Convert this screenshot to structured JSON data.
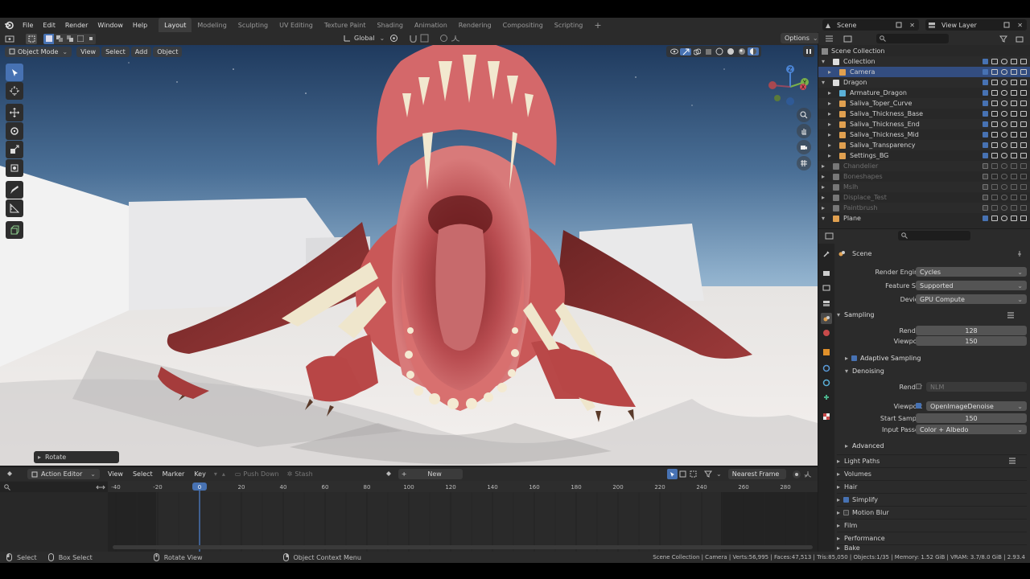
{
  "topbar": {
    "menus": [
      "File",
      "Edit",
      "Render",
      "Window",
      "Help"
    ],
    "workspaces": [
      "Layout",
      "Modeling",
      "Sculpting",
      "UV Editing",
      "Texture Paint",
      "Shading",
      "Animation",
      "Rendering",
      "Compositing",
      "Scripting"
    ],
    "active_workspace": "Layout",
    "add_tab": "+",
    "scene_name": "Scene",
    "view_layer": "View Layer"
  },
  "toolheader": {
    "orientation": "Global",
    "options": "Options"
  },
  "viewport": {
    "mode": "Object Mode",
    "menus": [
      "View",
      "Select",
      "Add",
      "Object"
    ],
    "last_op": "Rotate",
    "gizmo": {
      "x": "X",
      "y": "Y",
      "z": "Z"
    }
  },
  "outliner": {
    "search_placeholder": "",
    "root": "Scene Collection",
    "rows": [
      {
        "label": "Collection",
        "dim": false
      },
      {
        "label": "Camera",
        "dim": false,
        "selected": true
      },
      {
        "label": "Dragon",
        "dim": false
      },
      {
        "label": "Armature_Dragon",
        "dim": false
      },
      {
        "label": "Saliva_Toper_Curve",
        "dim": false
      },
      {
        "label": "Saliva_Thickness_Base",
        "dim": false
      },
      {
        "label": "Saliva_Thickness_End",
        "dim": false
      },
      {
        "label": "Saliva_Thickness_Mid",
        "dim": false
      },
      {
        "label": "Saliva_Transparency",
        "dim": false
      },
      {
        "label": "Settings_BG",
        "dim": false
      },
      {
        "label": "Chandelier",
        "dim": true
      },
      {
        "label": "Boneshapes",
        "dim": true
      },
      {
        "label": "Mslh",
        "dim": true
      },
      {
        "label": "Displace_Test",
        "dim": true
      },
      {
        "label": "Paintbrush",
        "dim": true
      },
      {
        "label": "Plane",
        "dim": false
      }
    ]
  },
  "properties": {
    "context": "Scene",
    "render_engine_label": "Render Engine",
    "render_engine": "Cycles",
    "feature_set_label": "Feature Set",
    "feature_set": "Supported",
    "device_label": "Device",
    "device": "GPU Compute",
    "sampling": "Sampling",
    "render_label": "Render",
    "render_samples": "128",
    "viewport_label": "Viewport",
    "viewport_samples": "150",
    "adaptive_sampling": "Adaptive Sampling",
    "denoising": "Denoising",
    "den_render_label": "Render",
    "den_render_value": "NLM",
    "den_viewport_label": "Viewport",
    "den_viewport_value": "OpenImageDenoise",
    "start_sample_label": "Start Sample",
    "start_sample": "150",
    "input_passes_label": "Input Passes",
    "input_passes": "Color + Albedo",
    "advanced": "Advanced",
    "sections": [
      "Light Paths",
      "Volumes",
      "Hair",
      "Simplify",
      "Motion Blur",
      "Film",
      "Performance",
      "Bake"
    ]
  },
  "timeline": {
    "editor": "Action Editor",
    "menus": [
      "View",
      "Select",
      "Marker",
      "Key"
    ],
    "push_down": "Push Down",
    "stash": "Stash",
    "new_label": "New",
    "snap": "Nearest Frame",
    "current_frame": "0",
    "ticks": [
      "-40",
      "-20",
      "0",
      "20",
      "40",
      "60",
      "80",
      "100",
      "120",
      "140",
      "160",
      "180",
      "200",
      "220",
      "240",
      "260",
      "280"
    ]
  },
  "statusbar": {
    "select": "Select",
    "box_select": "Box Select",
    "rotate_view": "Rotate View",
    "context_menu": "Object Context Menu",
    "stats": "Scene Collection | Camera | Verts:56,995 | Faces:47,513 | Tris:85,050 | Objects:1/35 | Memory: 1.52 GiB | VRAM: 3.7/8.0 GiB | 2.93.4"
  },
  "colors": {
    "accent": "#4772b3",
    "dragon": "#c24a4c",
    "teeth": "#f2e8cf"
  }
}
